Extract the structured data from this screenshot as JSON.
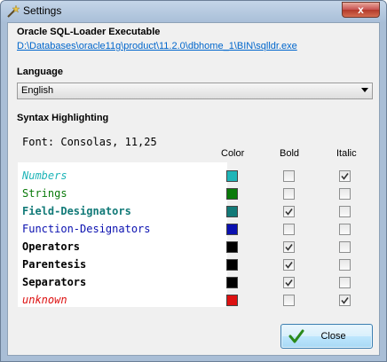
{
  "window": {
    "title": "Settings",
    "close_glyph": "x"
  },
  "executable": {
    "heading": "Oracle SQL-Loader Executable",
    "path": "D:\\Databases\\oracle11g\\product\\11.2.0\\dbhome_1\\BIN\\sqlldr.exe"
  },
  "language": {
    "heading": "Language",
    "selected": "English"
  },
  "syntax": {
    "heading": "Syntax Highlighting",
    "font_label": "Font: Consolas, 11,25",
    "columns": {
      "color": "Color",
      "bold": "Bold",
      "italic": "Italic"
    },
    "items": [
      {
        "name": "Numbers",
        "color": "#1fb5b8",
        "bold": false,
        "italic": true
      },
      {
        "name": "Strings",
        "color": "#0a7a0a",
        "bold": false,
        "italic": false
      },
      {
        "name": "Field-Designators",
        "color": "#127a78",
        "bold": true,
        "italic": false
      },
      {
        "name": "Function-Designators",
        "color": "#0a10b0",
        "bold": false,
        "italic": false
      },
      {
        "name": "Operators",
        "color": "#000000",
        "bold": true,
        "italic": false
      },
      {
        "name": "Parentesis",
        "color": "#000000",
        "bold": true,
        "italic": false
      },
      {
        "name": "Separators",
        "color": "#000000",
        "bold": true,
        "italic": false
      },
      {
        "name": "unknown",
        "color": "#dd1111",
        "bold": false,
        "italic": true
      }
    ]
  },
  "buttons": {
    "close_label": "Close"
  }
}
